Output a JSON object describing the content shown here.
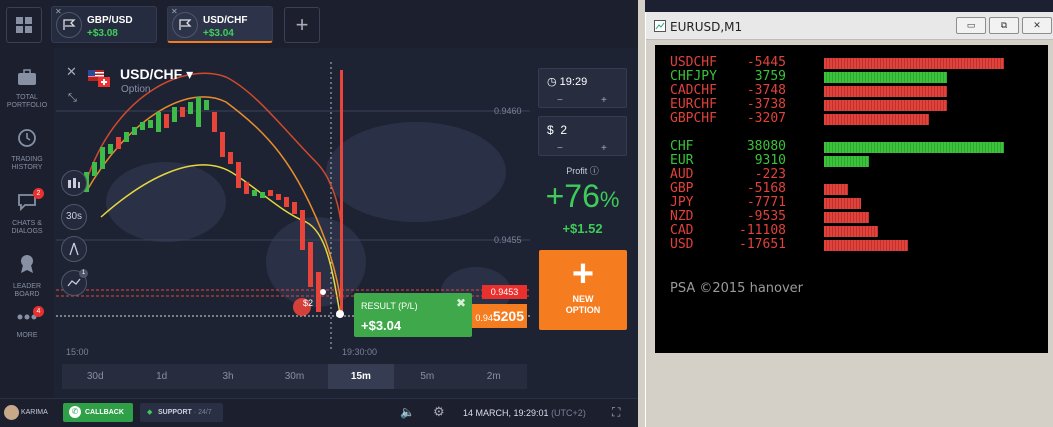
{
  "tabs": [
    {
      "name": "GBP/USD",
      "profit": "+$3.08"
    },
    {
      "name": "USD/CHF",
      "profit": "+$3.04"
    }
  ],
  "sidebar": [
    {
      "label": "TOTAL PORTFOLIO",
      "icon": "briefcase-icon"
    },
    {
      "label": "TRADING HISTORY",
      "icon": "history-icon"
    },
    {
      "label": "CHATS & DIALOGS",
      "icon": "chat-icon",
      "badge": "2"
    },
    {
      "label": "LEADER BOARD",
      "icon": "award-icon"
    },
    {
      "label": "MORE",
      "icon": "more-icon",
      "badge": "4"
    }
  ],
  "asset": {
    "title": "USD/CHF",
    "type": "Option"
  },
  "chart": {
    "prices": [
      "0.9460",
      "0.9455"
    ],
    "times": [
      "15:00",
      "19:30:00"
    ],
    "strike": "0.9453",
    "current_prefix": "0.94",
    "current_suffix": "5205",
    "tools": [
      "30s",
      "1"
    ],
    "trade_tag": "$2"
  },
  "timeframes": [
    "30d",
    "1d",
    "3h",
    "30m",
    "15m",
    "5m",
    "2m"
  ],
  "active_timeframe": "15m",
  "expiry": {
    "time": "19:29",
    "minus": "−",
    "plus": "+"
  },
  "amount": {
    "symbol": "$",
    "value": "2"
  },
  "profit": {
    "label": "Profit",
    "pct": "+76",
    "pct_sign": "%",
    "amount": "+$1.52"
  },
  "new_option": {
    "label": "NEW OPTION"
  },
  "result": {
    "header": "RESULT (P/L)",
    "value": "+$3.04"
  },
  "bottom": {
    "user": "KARIMA",
    "callback": "CALLBACK",
    "support": "SUPPORT",
    "support_suffix": "· 24/7",
    "datetime": "14 MARCH, 19:29:01",
    "tz": "(UTC+2)"
  },
  "mt4": {
    "title": "EURUSD,M1",
    "pairs": [
      {
        "symbol": "USDCHF",
        "value": "-5445",
        "dir": "red",
        "bar": 0.48
      },
      {
        "symbol": "CHFJPY",
        "value": "3759",
        "dir": "green",
        "bar": 0.33
      },
      {
        "symbol": "CADCHF",
        "value": "-3748",
        "dir": "red",
        "bar": 0.33
      },
      {
        "symbol": "EURCHF",
        "value": "-3738",
        "dir": "red",
        "bar": 0.33
      },
      {
        "symbol": "GBPCHF",
        "value": "-3207",
        "dir": "red",
        "bar": 0.28
      }
    ],
    "currencies": [
      {
        "symbol": "CHF",
        "value": "38080",
        "dir": "green",
        "bar": 0.48
      },
      {
        "symbol": "EUR",
        "value": "9310",
        "dir": "green",
        "bar": 0.12
      },
      {
        "symbol": "AUD",
        "value": "-223",
        "dir": "red",
        "bar": 0.0
      },
      {
        "symbol": "GBP",
        "value": "-5168",
        "dir": "red",
        "bar": 0.065
      },
      {
        "symbol": "JPY",
        "value": "-7771",
        "dir": "red",
        "bar": 0.1
      },
      {
        "symbol": "NZD",
        "value": "-9535",
        "dir": "red",
        "bar": 0.12
      },
      {
        "symbol": "CAD",
        "value": "-11108",
        "dir": "red",
        "bar": 0.145
      },
      {
        "symbol": "USD",
        "value": "-17651",
        "dir": "red",
        "bar": 0.225
      }
    ],
    "copyright": "PSA ©2015 hanover",
    "colors": {
      "label": "#e0423c",
      "green": "#3bc33b"
    }
  }
}
